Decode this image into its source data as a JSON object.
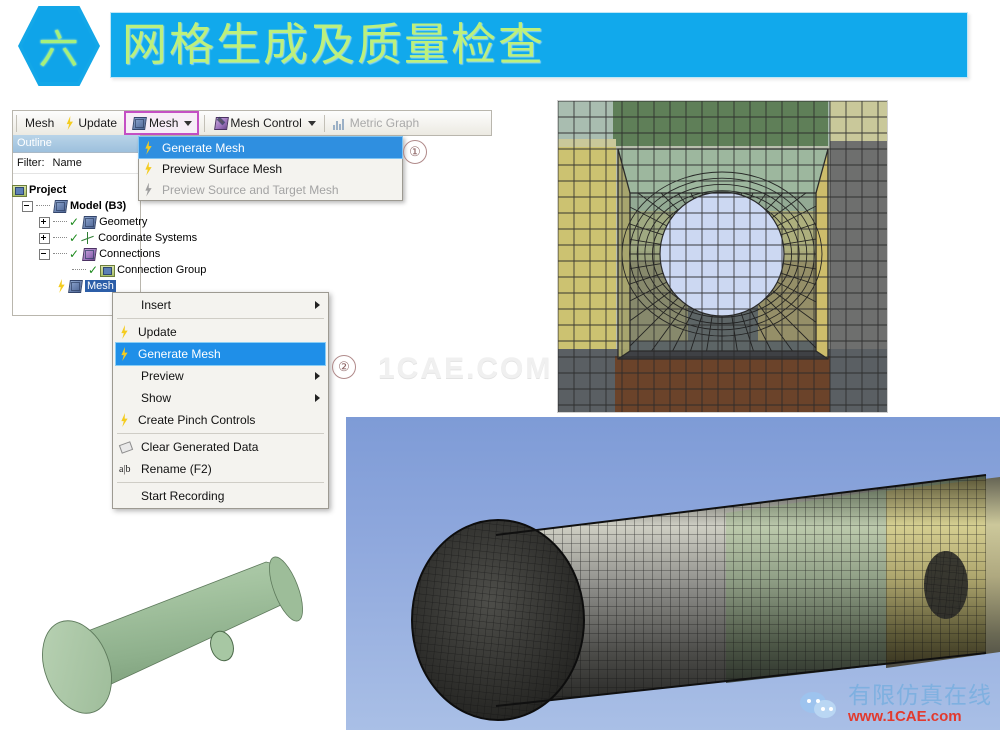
{
  "title": {
    "badge": "六",
    "heading": "网格生成及质量检查"
  },
  "toolbar": {
    "mesh_label": "Mesh",
    "update_label": "Update",
    "mesh_menu_label": "Mesh",
    "mesh_control_label": "Mesh Control",
    "metric_graph_label": "Metric Graph",
    "highlight_color": "#c44fc4"
  },
  "outline": {
    "header": "Outline",
    "filter_label": "Filter:",
    "filter_value": "Name",
    "tree": [
      {
        "label": "Project",
        "indent": 0,
        "expander": "none",
        "check": false,
        "icon": "folder-icon",
        "bold": true,
        "selected": false
      },
      {
        "label": "Model (B3)",
        "indent": 1,
        "expander": "minus",
        "check": false,
        "icon": "model-cube-icon",
        "bold": true,
        "selected": false
      },
      {
        "label": "Geometry",
        "indent": 2,
        "expander": "plus",
        "check": true,
        "icon": "geometry-icon",
        "bold": false,
        "selected": false
      },
      {
        "label": "Coordinate Systems",
        "indent": 2,
        "expander": "plus",
        "check": true,
        "icon": "axes-icon",
        "bold": false,
        "selected": false
      },
      {
        "label": "Connections",
        "indent": 2,
        "expander": "minus",
        "check": true,
        "icon": "connections-icon",
        "bold": false,
        "selected": false
      },
      {
        "label": "Connection Group",
        "indent": 3,
        "expander": "none",
        "check": true,
        "icon": "group-icon",
        "bold": false,
        "selected": false
      },
      {
        "label": "Mesh",
        "indent": 2,
        "expander": "none",
        "check": false,
        "icon": "mesh-icon",
        "bold": false,
        "selected": true
      }
    ]
  },
  "mesh_dropdown": {
    "items": [
      {
        "label": "Generate Mesh",
        "icon": "bolt-icon",
        "state": "selected"
      },
      {
        "label": "Preview Surface Mesh",
        "icon": "bolt-icon",
        "state": "normal"
      },
      {
        "label": "Preview Source and Target Mesh",
        "icon": "bolt-gray-icon",
        "state": "disabled"
      }
    ]
  },
  "context_menu": {
    "items": [
      {
        "label": "Insert",
        "icon": "none",
        "submenu": true,
        "state": "normal",
        "separator_after": true
      },
      {
        "label": "Update",
        "icon": "bolt-icon",
        "submenu": false,
        "state": "normal",
        "separator_after": false
      },
      {
        "label": "Generate Mesh",
        "icon": "bolt-icon",
        "submenu": false,
        "state": "selected",
        "separator_after": false
      },
      {
        "label": "Preview",
        "icon": "none",
        "submenu": true,
        "state": "normal",
        "separator_after": false
      },
      {
        "label": "Show",
        "icon": "none",
        "submenu": true,
        "state": "normal",
        "separator_after": false
      },
      {
        "label": "Create Pinch Controls",
        "icon": "bolt-icon",
        "submenu": false,
        "state": "normal",
        "separator_after": true
      },
      {
        "label": "Clear Generated Data",
        "icon": "eraser-icon",
        "submenu": false,
        "state": "normal",
        "separator_after": false
      },
      {
        "label": "Rename (F2)",
        "icon": "rename-icon",
        "submenu": false,
        "state": "normal",
        "separator_after": true
      },
      {
        "label": "Start Recording",
        "icon": "none",
        "submenu": false,
        "state": "normal",
        "separator_after": false
      }
    ]
  },
  "markers": {
    "step_one": "①",
    "step_two": "②"
  },
  "watermarks": {
    "center": "1CAE.COM",
    "logo_cn": "有限仿真在线",
    "logo_url": "www.1CAE.com"
  },
  "views": {
    "mesh_section_view": "hex-mesh-cross-section-with-circular-hole",
    "mesh_3d_view": "meshed-cylinder-3d",
    "geometry_view": "green-cylinder-with-hole"
  }
}
